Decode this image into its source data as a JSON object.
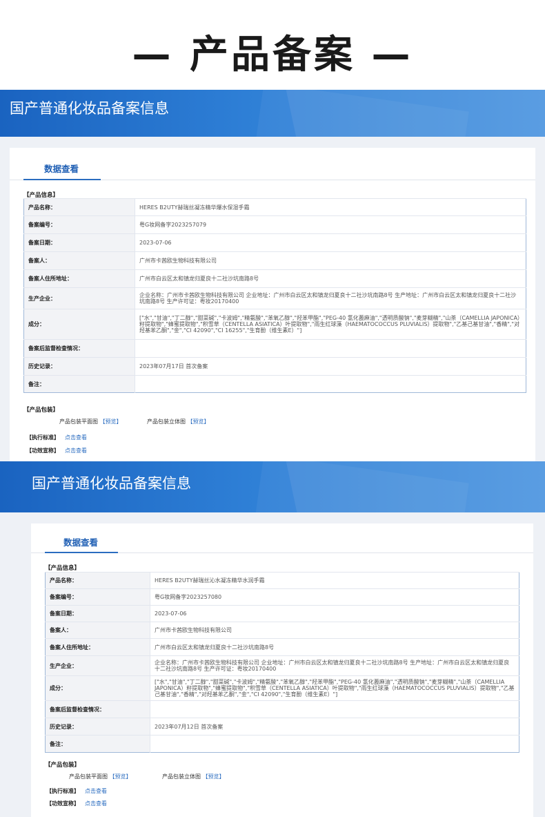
{
  "page_title": "— 产品备案 —",
  "sections": [
    {
      "banner_title": "国产普通化妆品备案信息",
      "tab_label": "数据查看",
      "product_info_label": "【产品信息】",
      "rows": [
        {
          "key": "产品名称：",
          "value": "HERES B2UTY赫瑞丝凝冻精华爆水保湿手霜"
        },
        {
          "key": "备案编号：",
          "value": "粤G妆网备字2023257079"
        },
        {
          "key": "备案日期：",
          "value": "2023-07-06"
        },
        {
          "key": "备案人：",
          "value": "广州市卡茜欧生物科技有限公司"
        },
        {
          "key": "备案人住所地址：",
          "value": "广州市白云区太和镇龙归夏良十二社沙坑南路8号"
        },
        {
          "key": "生产企业：",
          "value": "企业名称：广州市卡茜欧生物科技有限公司 企业地址：广州市白云区太和镇龙归夏良十二社沙坑南路8号 生产地址：广州市白云区太和镇龙归夏良十二社沙坑南路8号 生产许可证：粤妆20170400"
        },
        {
          "key": "成分：",
          "value": "[\"水\",\"甘油\",\"丁二醇\",\"甜菜碱\",\"卡波姆\",\"精氨酸\",\"苯氧乙醇\",\"羟苯甲酯\",\"PEG-40 氢化蓖麻油\",\"透明质酸钠\",\"麦芽糊精\",\"山茶（CAMELLIA JAPONICA）籽提取物\",\"蜂蜜提取物\",\"积雪草（CENTELLA ASIATICA）叶提取物\",\"雨生红球藻（HAEMATOCOCCUS PLUVIALIS）提取物\",\"乙基己基甘油\",\"香精\",\"对羟基苯乙酮\",\"金\",\"CI 42090\",\"CI 16255\",\"生育酚（维生素E）\"]"
        },
        {
          "key": "备案后监督检查情况：",
          "value": ""
        },
        {
          "key": "历史记录：",
          "value": "2023年07月17日 首次备案"
        },
        {
          "key": "备注：",
          "value": ""
        }
      ],
      "package_label": "【产品包装】",
      "package_flat_label": "产品包装平面图",
      "package_3d_label": "产品包装立体图",
      "preview_link": "【预览】",
      "standard_label": "【执行标准】",
      "efficacy_label": "【功效宣称】",
      "view_link": "点击查看"
    },
    {
      "banner_title": "国产普通化妆品备案信息",
      "tab_label": "数据查看",
      "product_info_label": "【产品信息】",
      "rows": [
        {
          "key": "产品名称：",
          "value": "HERES B2UTY赫瑞丝沁水凝冻精华水润手霜"
        },
        {
          "key": "备案编号：",
          "value": "粤G妆网备字2023257080"
        },
        {
          "key": "备案日期：",
          "value": "2023-07-06"
        },
        {
          "key": "备案人：",
          "value": "广州市卡茜欧生物科技有限公司"
        },
        {
          "key": "备案人住所地址：",
          "value": "广州市白云区太和镇龙归夏良十二社沙坑南路8号"
        },
        {
          "key": "生产企业：",
          "value": "企业名称：广州市卡茜欧生物科技有限公司 企业地址：广州市白云区太和镇龙归夏良十二社沙坑南路8号 生产地址：广州市白云区太和镇龙归夏良十二社沙坑南路8号 生产许可证：粤妆20170400"
        },
        {
          "key": "成分：",
          "value": "[\"水\",\"甘油\",\"丁二醇\",\"甜菜碱\",\"卡波姆\",\"精氨酸\",\"苯氧乙醇\",\"羟苯甲酯\",\"PEG-40 氢化蓖麻油\",\"透明质酸钠\",\"麦芽糊精\",\"山茶（CAMELLIA JAPONICA）籽提取物\",\"蜂蜜提取物\",\"积雪草（CENTELLA ASIATICA）叶提取物\",\"雨生红球藻（HAEMATOCOCCUS PLUVIALIS）提取物\",\"乙基己基甘油\",\"香精\",\"对羟基苯乙酮\",\"金\",\"CI 42090\",\"生育酚（维生素E）\"]"
        },
        {
          "key": "备案后监督检查情况：",
          "value": ""
        },
        {
          "key": "历史记录：",
          "value": "2023年07月12日 首次备案"
        },
        {
          "key": "备注：",
          "value": ""
        }
      ],
      "package_label": "【产品包装】",
      "package_flat_label": "产品包装平面图",
      "package_3d_label": "产品包装立体图",
      "preview_link": "【预览】",
      "standard_label": "【执行标准】",
      "efficacy_label": "【功效宣称】",
      "view_link": "点击查看"
    }
  ]
}
